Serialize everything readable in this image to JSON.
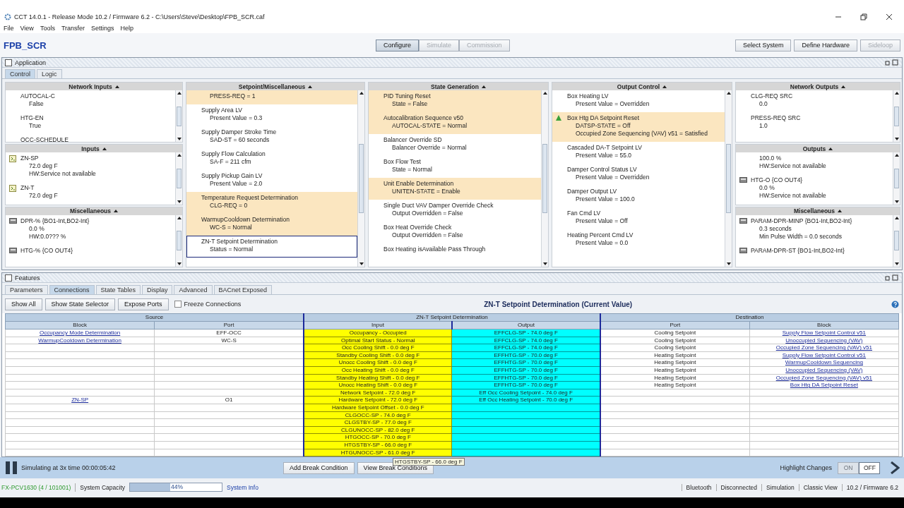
{
  "window": {
    "title": "CCT 14.0.1 - Release Mode 10.2 / Firmware 6.2 - C:\\Users\\Steve\\Desktop\\FPB_SCR.caf",
    "menu": [
      "File",
      "View",
      "Tools",
      "Transfer",
      "Settings",
      "Help"
    ]
  },
  "toolbar": {
    "app_name": "FPB_SCR",
    "modes": [
      {
        "label": "Configure",
        "selected": true,
        "disabled": false
      },
      {
        "label": "Simulate",
        "selected": false,
        "disabled": true
      },
      {
        "label": "Commission",
        "selected": false,
        "disabled": true
      }
    ],
    "actions": [
      {
        "label": "Select System",
        "disabled": false
      },
      {
        "label": "Define Hardware",
        "disabled": false
      },
      {
        "label": "Sideloop",
        "disabled": true
      }
    ]
  },
  "application": {
    "title": "Application",
    "checked": false,
    "tabs": [
      {
        "label": "Control",
        "selected": true
      },
      {
        "label": "Logic",
        "selected": false
      }
    ],
    "columns": [
      {
        "sections": [
          {
            "title": "Network Inputs",
            "items": [
              {
                "kind": "plain",
                "title": "AUTOCAL-C",
                "lines": [
                  "False"
                ],
                "highlighted": false,
                "selected": false
              },
              {
                "kind": "plain",
                "title": "HTG-EN",
                "lines": [
                  "True"
                ],
                "highlighted": false,
                "selected": false
              },
              {
                "kind": "plain",
                "title": "OCC-SCHEDULE",
                "highlighted": false,
                "selected": false
              }
            ]
          },
          {
            "title": "Inputs",
            "items": [
              {
                "kind": "input",
                "title": "ZN-SP",
                "lines": [
                  "72.0 deg F",
                  "HW:Service not available"
                ],
                "highlighted": false,
                "selected": false
              },
              {
                "kind": "input",
                "title": "ZN-T",
                "lines": [
                  "72.0 deg F"
                ],
                "highlighted": false,
                "selected": false
              }
            ]
          },
          {
            "title": "Miscellaneous",
            "items": [
              {
                "kind": "device",
                "title": "DPR-% {BO1-Int,BO2-Int}",
                "lines": [
                  "0.0 %",
                  "HW:0.0??? %"
                ],
                "highlighted": false,
                "selected": false
              },
              {
                "kind": "device",
                "title": "HTG-% {CO OUT4}",
                "highlighted": false,
                "selected": false
              }
            ]
          }
        ]
      },
      {
        "sections": [
          {
            "title": "Setpoint/Miscellaneous",
            "items": [
              {
                "kind": "plain",
                "lines": [
                  "PRESS-REQ = 1"
                ],
                "highlighted": true,
                "selected": false
              },
              {
                "kind": "plain",
                "title": "Supply Area LV",
                "lines": [
                  "Present Value = 0.3"
                ],
                "highlighted": false,
                "selected": false
              },
              {
                "kind": "plain",
                "title": "Supply Damper Stroke Time",
                "lines": [
                  "SAD-ST = 60 seconds"
                ],
                "highlighted": false,
                "selected": false
              },
              {
                "kind": "plain",
                "title": "Supply Flow Calculation",
                "lines": [
                  "SA-F = 211 cfm"
                ],
                "highlighted": false,
                "selected": false
              },
              {
                "kind": "plain",
                "title": "Supply Pickup Gain LV",
                "lines": [
                  "Present Value = 2.0"
                ],
                "highlighted": false,
                "selected": false
              },
              {
                "kind": "plain",
                "title": "Temperature Request Determination",
                "lines": [
                  "CLG-REQ = 0"
                ],
                "highlighted": true,
                "selected": false
              },
              {
                "kind": "plain",
                "title": "WarmupCooldown Determination",
                "lines": [
                  "WC-S = Normal"
                ],
                "highlighted": true,
                "selected": false
              },
              {
                "kind": "plain",
                "title": "ZN-T Setpoint Determination",
                "lines": [
                  "Status = Normal"
                ],
                "highlighted": false,
                "selected": true
              }
            ]
          }
        ]
      },
      {
        "sections": [
          {
            "title": "State Generation",
            "items": [
              {
                "kind": "plain",
                "title": "PID Tuning Reset",
                "lines": [
                  "State = False"
                ],
                "highlighted": true,
                "selected": false
              },
              {
                "kind": "plain",
                "title": "Autocalibration Sequence v50",
                "lines": [
                  "AUTOCAL-STATE = Normal"
                ],
                "highlighted": true,
                "selected": false
              },
              {
                "kind": "plain",
                "title": "Balancer Override SD",
                "lines": [
                  "Balancer Override = Normal"
                ],
                "highlighted": false,
                "selected": false
              },
              {
                "kind": "plain",
                "title": "Box Flow Test",
                "lines": [
                  "State = Normal"
                ],
                "highlighted": false,
                "selected": false
              },
              {
                "kind": "plain",
                "title": "Unit Enable Determination",
                "lines": [
                  "UNITEN-STATE = Enable"
                ],
                "highlighted": true,
                "selected": false
              },
              {
                "kind": "plain",
                "title": "Single Duct VAV Damper Override Check",
                "lines": [
                  "Output Overridden = False"
                ],
                "highlighted": false,
                "selected": false
              },
              {
                "kind": "plain",
                "title": "Box Heat Override Check",
                "lines": [
                  "Output Overridden = False"
                ],
                "highlighted": false,
                "selected": false
              },
              {
                "kind": "plain",
                "title": "Box Heating isAvailable Pass Through",
                "highlighted": false,
                "selected": false
              }
            ]
          }
        ]
      },
      {
        "sections": [
          {
            "title": "Output Control",
            "items": [
              {
                "kind": "plain",
                "title": "Box Heating LV",
                "lines": [
                  "Present Value = Overridden"
                ],
                "highlighted": false,
                "selected": false
              },
              {
                "kind": "changed",
                "title": "Box Htg DA Setpoint Reset",
                "lines": [
                  "DATSP-STATE = Off",
                  "Occupied Zone Sequencing (VAV) v51 = Satisfied"
                ],
                "highlighted": true,
                "selected": false
              },
              {
                "kind": "plain",
                "title": "Cascaded DA-T Setpoint LV",
                "lines": [
                  "Present Value = 55.0"
                ],
                "highlighted": false,
                "selected": false
              },
              {
                "kind": "plain",
                "title": "Damper Control Status LV",
                "lines": [
                  "Present Value = Overridden"
                ],
                "highlighted": false,
                "selected": false
              },
              {
                "kind": "plain",
                "title": "Damper Output LV",
                "lines": [
                  "Present Value = 100.0"
                ],
                "highlighted": false,
                "selected": false
              },
              {
                "kind": "plain",
                "title": "Fan Cmd LV",
                "lines": [
                  "Present Value = Off"
                ],
                "highlighted": false,
                "selected": false
              },
              {
                "kind": "plain",
                "title": "Heating Percent Cmd LV",
                "lines": [
                  "Present Value = 0.0"
                ],
                "highlighted": false,
                "selected": false
              }
            ]
          }
        ]
      },
      {
        "sections": [
          {
            "title": "Network Outputs",
            "items": [
              {
                "kind": "plain",
                "title": "CLG-REQ SRC",
                "lines": [
                  "0.0"
                ],
                "highlighted": false,
                "selected": false
              },
              {
                "kind": "plain",
                "title": "PRESS-REQ SRC",
                "lines": [
                  "1.0"
                ],
                "highlighted": false,
                "selected": false
              }
            ]
          },
          {
            "title": "Outputs",
            "items": [
              {
                "kind": "plain",
                "lines": [
                  "100.0 %",
                  "HW:Service not available"
                ],
                "highlighted": false,
                "selected": false
              },
              {
                "kind": "device",
                "title": "HTG-O {CO OUT4}",
                "lines": [
                  "0.0 %",
                  "HW:Service not available"
                ],
                "highlighted": false,
                "selected": false
              }
            ]
          },
          {
            "title": "Miscellaneous",
            "items": [
              {
                "kind": "device",
                "title": "PARAM-DPR-MINP {BO1-Int,BO2-Int}",
                "lines": [
                  "0.3 seconds",
                  "Min Pulse Width = 0.0 seconds"
                ],
                "highlighted": false,
                "selected": false
              },
              {
                "kind": "device",
                "title": "PARAM-DPR-ST {BO1-Int,BO2-Int}",
                "highlighted": false,
                "selected": false
              }
            ]
          }
        ]
      }
    ]
  },
  "features": {
    "title": "Features",
    "checked": false,
    "tabs": [
      {
        "label": "Parameters",
        "selected": false
      },
      {
        "label": "Connections",
        "selected": true
      },
      {
        "label": "State Tables",
        "selected": false
      },
      {
        "label": "Display",
        "selected": false
      },
      {
        "label": "Advanced",
        "selected": false
      },
      {
        "label": "BACnet Exposed",
        "selected": false
      }
    ],
    "buttons": [
      "Show All",
      "Show State Selector",
      "Expose Ports"
    ],
    "freeze": {
      "label": "Freeze Connections",
      "checked": false
    },
    "heading": "ZN-T Setpoint Determination (Current Value)",
    "table": {
      "groups": [
        "Source",
        "ZN-T Setpoint Determination",
        "Destination"
      ],
      "columns": [
        "Block",
        "Port",
        "Input",
        "Output",
        "Port",
        "Block"
      ],
      "rows": [
        {
          "source_block": "Occupancy Mode Determination",
          "source_port": "EFF-OCC",
          "input": "Occupancy - Occupied",
          "output": "EFFCLG-SP - 74.0 deg F",
          "dest_port": "Cooling Setpoint",
          "dest_block": "Supply Flow Setpoint Control v51"
        },
        {
          "source_block": "WarmupCooldown Determination",
          "source_port": "WC-S",
          "input": "Optimal Start Status - Normal",
          "output": "EFFCLG-SP - 74.0 deg F",
          "dest_port": "Cooling Setpoint",
          "dest_block": "Unoccupied Sequencing (VAV)"
        },
        {
          "input": "Occ Cooling Shift - 0.0 deg F",
          "output": "EFFCLG-SP - 74.0 deg F",
          "dest_port": "Cooling Setpoint",
          "dest_block": "Occupied Zone Sequencing (VAV) v51"
        },
        {
          "input": "Standby Cooling Shift - 0.0 deg F",
          "output": "EFFHTG-SP - 70.0 deg F",
          "dest_port": "Heating Setpoint",
          "dest_block": "Supply Flow Setpoint Control v51"
        },
        {
          "input": "Unocc Cooling Shift - 0.0 deg F",
          "output": "EFFHTG-SP - 70.0 deg F",
          "dest_port": "Heating Setpoint",
          "dest_block": "WarmupCooldown Sequencing"
        },
        {
          "input": "Occ Heating Shift - 0.0 deg F",
          "output": "EFFHTG-SP - 70.0 deg F",
          "dest_port": "Heating Setpoint",
          "dest_block": "Unoccupied Sequencing (VAV)"
        },
        {
          "input": "Standby Heating Shift - 0.0 deg F",
          "output": "EFFHTG-SP - 70.0 deg F",
          "dest_port": "Heating Setpoint",
          "dest_block": "Occupied Zone Sequencing (VAV) v51"
        },
        {
          "input": "Unocc Heating Shift - 0.0 deg F",
          "output": "EFFHTG-SP - 70.0 deg F",
          "dest_port": "Heating Setpoint",
          "dest_block": "Box Htg DA Setpoint Reset"
        },
        {
          "input": "Network Setpoint - 72.0 deg F",
          "output": "Eff Occ Cooling Setpoint - 74.0 deg F"
        },
        {
          "source_block": "ZN-SP",
          "source_port": "O1",
          "input": "Hardware Setpoint - 72.0 deg F",
          "output": "Eff Occ Heating Setpoint - 70.0 deg F"
        },
        {
          "input": "Hardware Setpoint Offset - 0.0 deg F"
        },
        {
          "input": "CLGOCC-SP - 74.0 deg F"
        },
        {
          "input": "CLGSTBY-SP - 77.0 deg F"
        },
        {
          "input": "CLGUNOCC-SP - 82.0 deg F"
        },
        {
          "input": "HTGOCC-SP - 70.0 deg F"
        },
        {
          "input": "HTGSTBY-SP - 66.0 deg F"
        },
        {
          "input": "HTGUNOCC-SP - 61.0 deg F"
        }
      ]
    }
  },
  "simulation": {
    "status": "Simulating at 3x time 00:00:05:42",
    "buttons": [
      "Add Break Condition",
      "View Break Conditions"
    ],
    "tooltip": "HTGSTBY-SP - 66.0 deg F",
    "highlight_label": "Highlight Changes",
    "toggle": [
      {
        "label": "ON",
        "selected": false,
        "disabled": true
      },
      {
        "label": "OFF",
        "selected": true,
        "disabled": false
      }
    ]
  },
  "status_bar": {
    "device": "FX-PCV1630 (4 / 101001)",
    "capacity_label": "System Capacity",
    "capacity": {
      "level": 0.44,
      "reading": "44%"
    },
    "info_link": "System Info",
    "items": [
      "Bluetooth",
      "Disconnected",
      "Simulation",
      "Classic View",
      "10.2 / Firmware 6.2"
    ]
  }
}
